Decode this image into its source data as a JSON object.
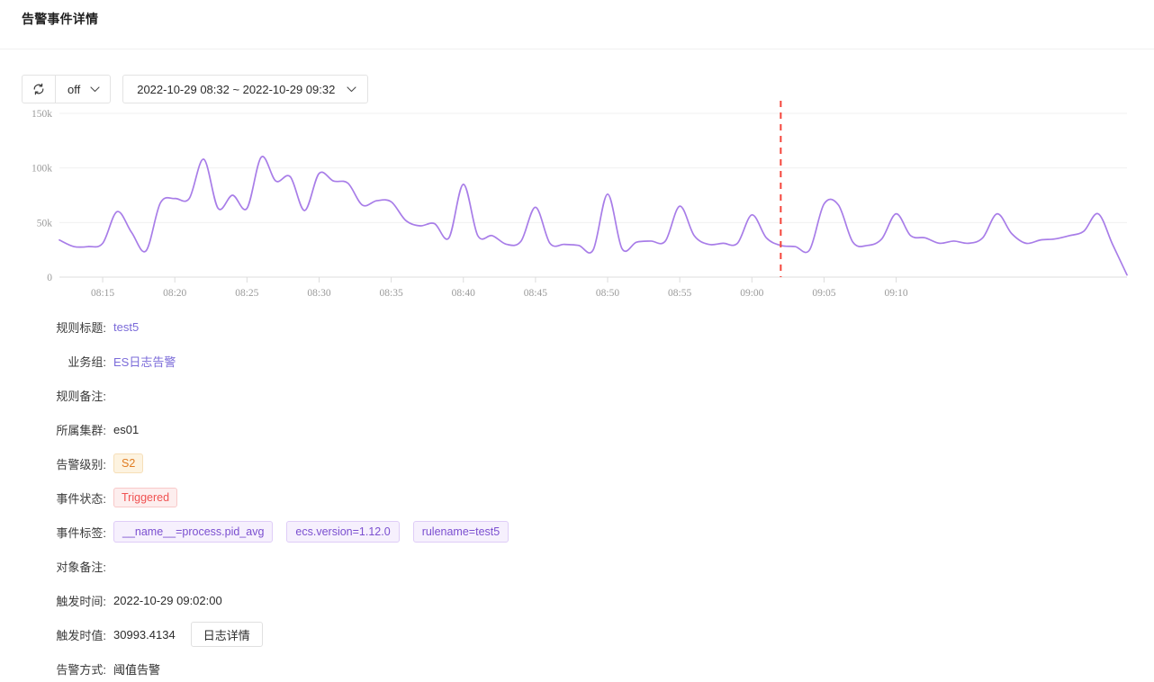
{
  "header": {
    "title": "告警事件详情"
  },
  "toolbar": {
    "refresh_icon": "refresh-icon",
    "interval_value": "off",
    "interval_caret": "chevron-down-icon",
    "range_value": "2022-10-29 08:32 ~ 2022-10-29 09:32",
    "range_caret": "chevron-down-icon"
  },
  "chart_data": {
    "type": "line",
    "title": "",
    "xlabel": "",
    "ylabel": "",
    "ylim": [
      0,
      150000
    ],
    "grid": true,
    "legend": "none",
    "line_color": "#a87de8",
    "marker_color": "#f5443a",
    "y_ticks": [
      "0",
      "50k",
      "100k",
      "150k"
    ],
    "y_tick_values": [
      0,
      50000,
      100000,
      150000
    ],
    "x_ticks": [
      "08:15",
      "08:20",
      "08:25",
      "08:30",
      "08:35",
      "08:40",
      "08:45",
      "08:50",
      "08:55",
      "09:00",
      "09:05",
      "09:10"
    ],
    "x_range": [
      "08:32",
      "09:32"
    ],
    "marker": {
      "label": "09:02",
      "value": 30993.4134,
      "style": "dashed-vertical"
    },
    "series": [
      {
        "name": "process.pid_avg",
        "x": [
          "08:12",
          "08:13",
          "08:14",
          "08:15",
          "08:16",
          "08:17",
          "08:18",
          "08:19",
          "08:20",
          "08:21",
          "08:22",
          "08:23",
          "08:24",
          "08:25",
          "08:26",
          "08:27",
          "08:28",
          "08:29",
          "08:30",
          "08:31",
          "08:32",
          "08:33",
          "08:34",
          "08:35",
          "08:36",
          "08:37",
          "08:38",
          "08:39",
          "08:40",
          "08:41",
          "08:42",
          "08:43",
          "08:44",
          "08:45",
          "08:46",
          "08:47",
          "08:48",
          "08:49",
          "08:50",
          "08:51",
          "08:52",
          "08:53",
          "08:54",
          "08:55",
          "08:56",
          "08:57",
          "08:58",
          "08:59",
          "09:00",
          "09:01",
          "09:02",
          "09:03",
          "09:04",
          "09:05",
          "09:06",
          "09:07",
          "09:08",
          "09:09",
          "09:10",
          "09:11",
          "09:12"
        ],
        "values": [
          34000,
          28000,
          28000,
          31000,
          60000,
          41000,
          24000,
          68000,
          72000,
          72000,
          108000,
          63000,
          75000,
          63000,
          110000,
          88000,
          92000,
          61000,
          95000,
          88000,
          86000,
          66000,
          70000,
          69000,
          52000,
          47000,
          49000,
          36000,
          85000,
          38000,
          38000,
          30000,
          33000,
          64000,
          31000,
          30000,
          29000,
          25000,
          76000,
          26000,
          32000,
          33000,
          33000,
          65000,
          38000,
          30000,
          31000,
          31000,
          57000,
          36000,
          29000,
          28000,
          25000,
          67000,
          66000,
          32000,
          29000,
          35000,
          58000,
          38000,
          36000,
          30993,
          33000,
          31000,
          36000,
          58000,
          40000,
          31000,
          34000,
          35000,
          38000,
          42000,
          58000,
          30000,
          2000
        ]
      }
    ]
  },
  "details": [
    {
      "label": "规则标题:",
      "type": "link",
      "value": "test5"
    },
    {
      "label": "业务组:",
      "type": "link",
      "value": "ES日志告警"
    },
    {
      "label": "规则备注:",
      "type": "text",
      "value": ""
    },
    {
      "label": "所属集群:",
      "type": "text",
      "value": "es01"
    },
    {
      "label": "告警级别:",
      "type": "badge-s2",
      "value": "S2"
    },
    {
      "label": "事件状态:",
      "type": "badge-trig",
      "value": "Triggered"
    },
    {
      "label": "事件标签:",
      "type": "tags",
      "tags": [
        "__name__=process.pid_avg",
        "ecs.version=1.12.0",
        "rulename=test5"
      ]
    },
    {
      "label": "对象备注:",
      "type": "text",
      "value": ""
    },
    {
      "label": "触发时间:",
      "type": "text",
      "value": "2022-10-29 09:02:00"
    },
    {
      "label": "触发时值:",
      "type": "text-button",
      "value": "30993.4134",
      "button": "日志详情"
    },
    {
      "label": "告警方式:",
      "type": "text",
      "value": "阈值告警"
    }
  ]
}
